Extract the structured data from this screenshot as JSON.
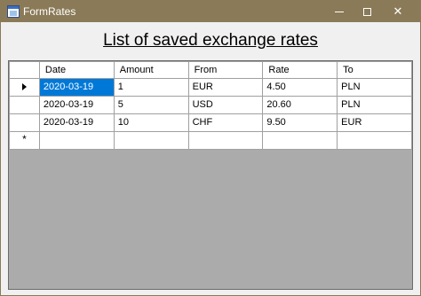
{
  "window": {
    "title": "FormRates",
    "minimize_icon": "minimize-icon",
    "maximize_icon": "maximize-icon",
    "close_glyph": "✕"
  },
  "heading": "List of saved exchange rates",
  "grid": {
    "columns": [
      "Date",
      "Amount",
      "From",
      "Rate",
      "To"
    ],
    "rows": [
      {
        "date": "2020-03-19",
        "amount": "1",
        "from": "EUR",
        "rate": "4.50",
        "to": "PLN"
      },
      {
        "date": "2020-03-19",
        "amount": "5",
        "from": "USD",
        "rate": "20.60",
        "to": "PLN"
      },
      {
        "date": "2020-03-19",
        "amount": "10",
        "from": "CHF",
        "rate": "9.50",
        "to": "EUR"
      }
    ],
    "new_row_marker": "*",
    "current_row_indicator": "current-row-arrow-icon",
    "selection_color": "#0078d7",
    "background_color": "#ababab"
  },
  "colors": {
    "titlebar": "#8a7a58"
  }
}
